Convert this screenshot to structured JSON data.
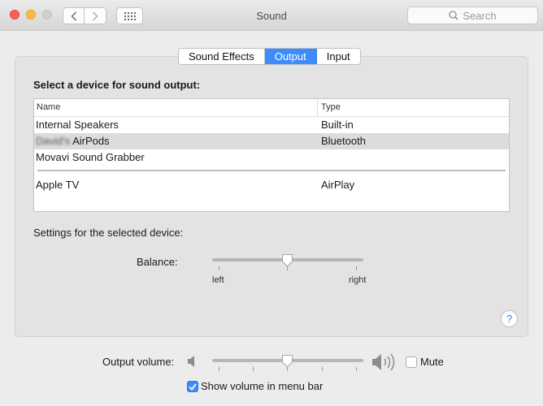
{
  "window": {
    "title": "Sound"
  },
  "search": {
    "placeholder": "Search"
  },
  "tabs": [
    {
      "label": "Sound Effects",
      "active": false
    },
    {
      "label": "Output",
      "active": true
    },
    {
      "label": "Input",
      "active": false
    }
  ],
  "output": {
    "heading": "Select a device for sound output:",
    "columns": {
      "name": "Name",
      "type": "Type"
    },
    "devices": [
      {
        "name": "Internal Speakers",
        "type": "Built-in",
        "selected": false
      },
      {
        "name": "David's",
        "name_suffix": "AirPods",
        "type": "Bluetooth",
        "selected": true
      },
      {
        "name": "Movavi Sound Grabber",
        "type": "",
        "selected": false
      },
      {
        "name": "Apple TV",
        "type": "AirPlay",
        "selected": false
      }
    ],
    "settings_label": "Settings for the selected device:",
    "balance": {
      "label": "Balance:",
      "left_label": "left",
      "right_label": "right",
      "value": 0.5
    }
  },
  "volume": {
    "label": "Output volume:",
    "value": 0.5,
    "mute_label": "Mute",
    "muted": false
  },
  "menu_bar": {
    "label": "Show volume in menu bar",
    "checked": true
  },
  "help": {
    "label": "?"
  },
  "colors": {
    "accent": "#3c8cfb",
    "close": "#fc605c",
    "minimize": "#fdbc40"
  }
}
